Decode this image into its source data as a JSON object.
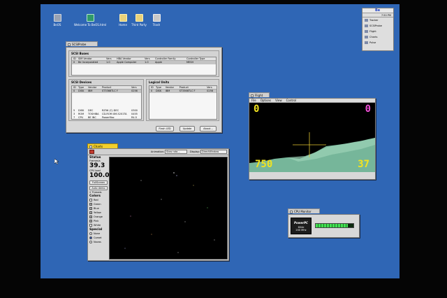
{
  "desktop_icons": [
    {
      "label": "BeOS",
      "icon": "disk-icon"
    },
    {
      "label": "Welcome To BeOS.html",
      "icon": "document-icon"
    },
    {
      "label": "Home",
      "icon": "folder-icon"
    },
    {
      "label": "Third Party",
      "icon": "folder-icon"
    },
    {
      "label": "Trash",
      "icon": "trash-icon"
    }
  ],
  "deskbar": {
    "logo": "Be",
    "clock": "7:50 PM",
    "apps": [
      "Tracker",
      "SCSIProbe",
      "Flight",
      "Charts",
      "Pulse"
    ]
  },
  "scsiprobe": {
    "title": "SCSIProbe",
    "buses": {
      "heading": "SCSI Buses",
      "columns": [
        "ID",
        "SIM Vendor",
        "Vers",
        "HBA Vendor",
        "Vers",
        "Controller Family",
        "Controller Type"
      ],
      "rows": [
        [
          "0",
          "Be Incorporated",
          "1.0",
          "Apple Computer",
          "1.0",
          "Apple",
          "MESH"
        ]
      ]
    },
    "devices": {
      "heading": "SCSI Devices",
      "columns": [
        "ID",
        "Type",
        "Vendor",
        "Product",
        "Vers"
      ],
      "rows": [
        [
          "0",
          "DISK",
          "IBM",
          "ST3366TLC   F",
          "0256"
        ],
        [
          "",
          "",
          "",
          "",
          ""
        ],
        [
          "",
          "",
          "",
          "",
          ""
        ],
        [
          "5",
          "DISK",
          "DEC",
          "RZ56   (C) DEC",
          "0300"
        ],
        [
          "3",
          "ROM",
          "TOSHIBA",
          "CD-ROM XM-5201TA",
          "0455"
        ],
        [
          "7",
          "CPU",
          "BE INC",
          "PowerMac",
          "R4.5"
        ]
      ]
    },
    "logical": {
      "heading": "Logical Units",
      "columns": [
        "ID",
        "Type",
        "Vendor",
        "Product",
        "Vers"
      ],
      "rows": [
        [
          "0",
          "DISK",
          "IBM",
          "ST3366TLC   F",
          "0256"
        ]
      ]
    },
    "buttons": [
      "Flash LED",
      "Update",
      "About..."
    ]
  },
  "flight": {
    "title": "Flight",
    "menu": [
      "File",
      "Options",
      "View",
      "Control"
    ],
    "readouts": {
      "top_left": "0",
      "top_right": "0",
      "bottom_left": "750",
      "bottom_right": "37"
    },
    "colors": {
      "yellow": "#f2e31f",
      "magenta": "#ee4fd6",
      "terrain": "#76b69a"
    }
  },
  "charts": {
    "title": "Charts",
    "toolbar": {
      "animation_label": "Animation:",
      "animation_value": "Slow rota...",
      "display_label": "Display:",
      "display_value": "DirectWindow"
    },
    "status": {
      "heading": "Status",
      "fps": "39.3",
      "fps_label": "Frames/s",
      "cpu": "100.0",
      "cpu_label": "CPU load",
      "fullscreen_button": "FullScreen",
      "auto_demo_button": "Auto demo",
      "threads": "2 Threads"
    },
    "colors": {
      "heading": "Colors",
      "items": [
        {
          "label": "Red",
          "checked": false
        },
        {
          "label": "Green",
          "checked": true
        },
        {
          "label": "Blue",
          "checked": true
        },
        {
          "label": "Yellow",
          "checked": true
        },
        {
          "label": "Orange",
          "checked": true
        },
        {
          "label": "Pink",
          "checked": true
        },
        {
          "label": "White",
          "checked": false
        }
      ]
    },
    "special": {
      "heading": "Special",
      "items": [
        {
          "label": "None",
          "selected": false
        },
        {
          "label": "Comet",
          "selected": true
        },
        {
          "label": "Novas",
          "selected": false
        }
      ]
    }
  },
  "cpu_monitor": {
    "title": "CPU Monitor",
    "badge_brand": "PowerPC",
    "badge_line1": "604e",
    "badge_line2": "200 MHz",
    "load": 0.85
  }
}
